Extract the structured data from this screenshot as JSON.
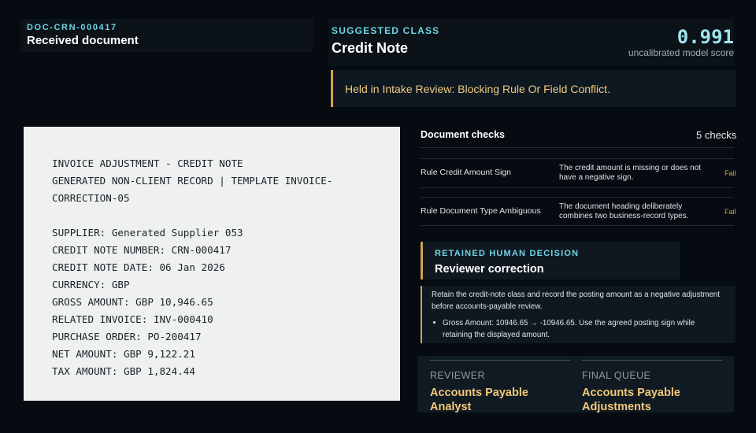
{
  "document": {
    "id": "DOC-CRN-000417",
    "label": "Received document",
    "lines": [
      "INVOICE ADJUSTMENT - CREDIT NOTE",
      "GENERATED NON-CLIENT RECORD | TEMPLATE INVOICE-",
      "CORRECTION-05",
      "",
      "SUPPLIER: Generated Supplier 053",
      "CREDIT NOTE NUMBER: CRN-000417",
      "CREDIT NOTE DATE: 06 Jan 2026",
      "CURRENCY: GBP",
      "GROSS AMOUNT: GBP 10,946.65",
      "RELATED INVOICE: INV-000410",
      "PURCHASE ORDER: PO-200417",
      "NET AMOUNT: GBP 9,122.21",
      "TAX AMOUNT: GBP 1,824.44"
    ]
  },
  "classification": {
    "kicker": "SUGGESTED CLASS",
    "value": "Credit Note",
    "score": "0.991",
    "score_label": "uncalibrated model score"
  },
  "banner": {
    "text": "Held in Intake Review: Blocking Rule Or Field Conflict."
  },
  "checks": {
    "title": "Document checks",
    "count": "5 checks",
    "rows": [
      {
        "name": "Rule Credit Amount Sign",
        "description": "The credit amount is missing or does not have a negative sign.",
        "status": "Fail"
      },
      {
        "name": "Rule Document Type Ambiguous",
        "description": "The document heading deliberately combines two business-record types.",
        "status": "Fail"
      }
    ]
  },
  "decision": {
    "kicker": "RETAINED HUMAN DECISION",
    "title": "Reviewer correction",
    "note": "Retain the credit-note class and record the posting amount as a negative adjustment before accounts-payable review.",
    "bullet": "Gross Amount: 10946.65 → -10946.65. Use the agreed posting sign while retaining the displayed amount."
  },
  "routing": {
    "reviewer_label": "REVIEWER",
    "reviewer_value": "Accounts Payable Analyst",
    "queue_label": "FINAL QUEUE",
    "queue_value": "Accounts Payable Adjustments"
  },
  "colors": {
    "accent": "#6fd3e3",
    "warning": "#d3a24f",
    "background": "#050b10"
  }
}
